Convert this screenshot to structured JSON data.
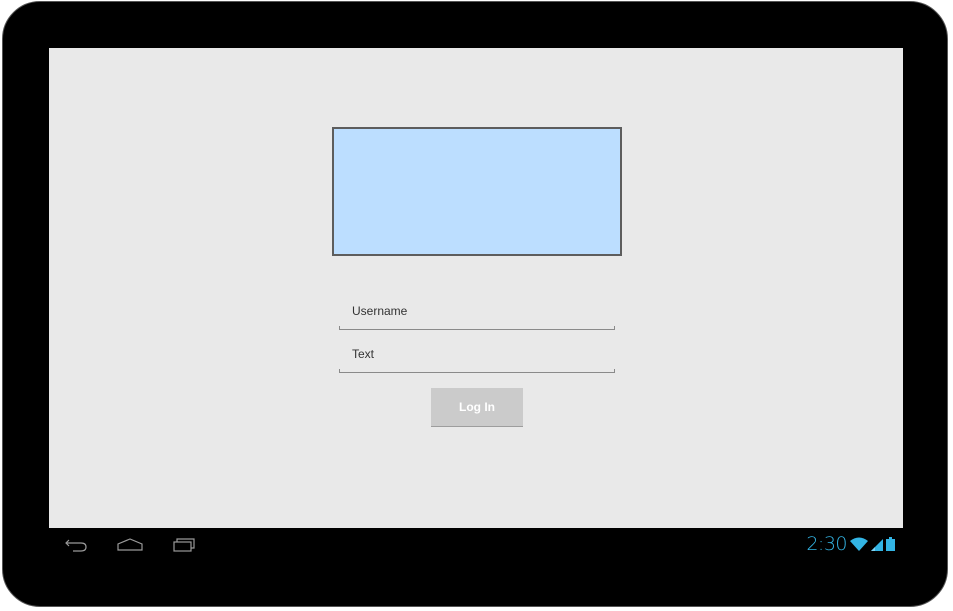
{
  "login": {
    "username_value": "Username",
    "text_value": "Text",
    "login_label": "Log In"
  },
  "statusbar": {
    "time": "2:30",
    "time_color": "#33b5e5"
  },
  "navbar": {
    "icons": [
      "back-icon",
      "home-icon",
      "recent-apps-icon"
    ]
  },
  "status_icons": [
    "wifi-icon",
    "signal-icon",
    "battery-icon"
  ],
  "colors": {
    "screen_background": "#e9e9e9",
    "image_placeholder_fill": "#bcdeff",
    "button_fill": "#cbcbcb"
  }
}
